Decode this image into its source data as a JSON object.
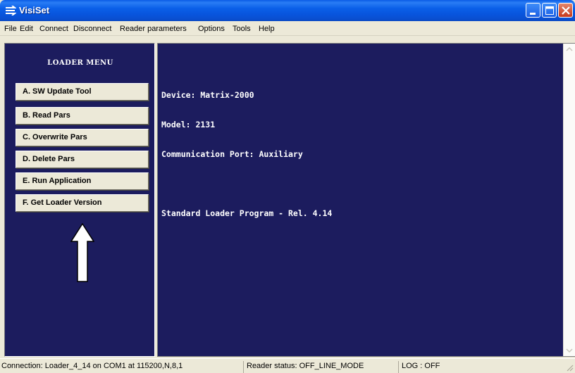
{
  "window": {
    "title": "VisiSet",
    "title_icon": "visiset-app-icon",
    "controls": {
      "minimize_icon": "minimize-icon",
      "maximize_icon": "maximize-icon",
      "close_icon": "close-icon"
    },
    "titlebar_color": "#0a5fe8"
  },
  "menu": {
    "items": [
      {
        "label": "File"
      },
      {
        "label": "Edit"
      },
      {
        "label": "Connect"
      },
      {
        "label": "Disconnect"
      },
      {
        "label": "Reader parameters"
      },
      {
        "label": "Options"
      },
      {
        "label": "Tools"
      },
      {
        "label": "Help"
      }
    ]
  },
  "loader_menu": {
    "title": "LOADER MENU",
    "buttons": [
      {
        "label": "A. SW Update Tool"
      },
      {
        "label": "B. Read Pars"
      },
      {
        "label": "C. Overwrite Pars"
      },
      {
        "label": "D. Delete Pars"
      },
      {
        "label": "E. Run Application"
      },
      {
        "label": "F. Get Loader Version"
      }
    ],
    "arrow_icon": "up-arrow-icon",
    "panel_color": "#1c1c5e"
  },
  "console": {
    "lines": [
      "Device: Matrix-2000",
      "Model: 2131",
      "Communication Port: Auxiliary",
      "",
      "Standard Loader Program - Rel. 4.14"
    ],
    "background_color": "#1c1c5e",
    "text_color": "#ffffff"
  },
  "status": {
    "connection": "Connection: Loader_4_14 on COM1 at 115200,N,8,1",
    "reader_status": "Reader status: OFF_LINE_MODE",
    "log": "LOG : OFF"
  }
}
